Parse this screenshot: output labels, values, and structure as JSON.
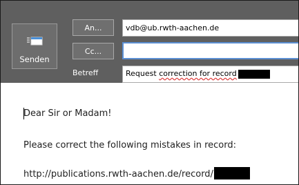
{
  "toolbar": {
    "send_label": "Senden",
    "send_icon": "send-mail-icon"
  },
  "fields": {
    "to_button_label": "An...",
    "to_value": "vdb@ub.rwth-aachen.de",
    "cc_button_label": "Cc...",
    "cc_value": "",
    "subject_label": "Betreff",
    "subject_prefix": "Request",
    "subject_misspelled": "correction for record"
  },
  "body": {
    "greeting": "Dear Sir or Madam!",
    "request_line": "Please correct the following mistakes in record:",
    "record_url": "http://publications.rwth-aachen.de/record/"
  },
  "colors": {
    "header_bg": "#5f5f5f",
    "button_bg": "#6f6f6f",
    "focus_border": "#5b8fd3",
    "redaction": "#000000"
  }
}
